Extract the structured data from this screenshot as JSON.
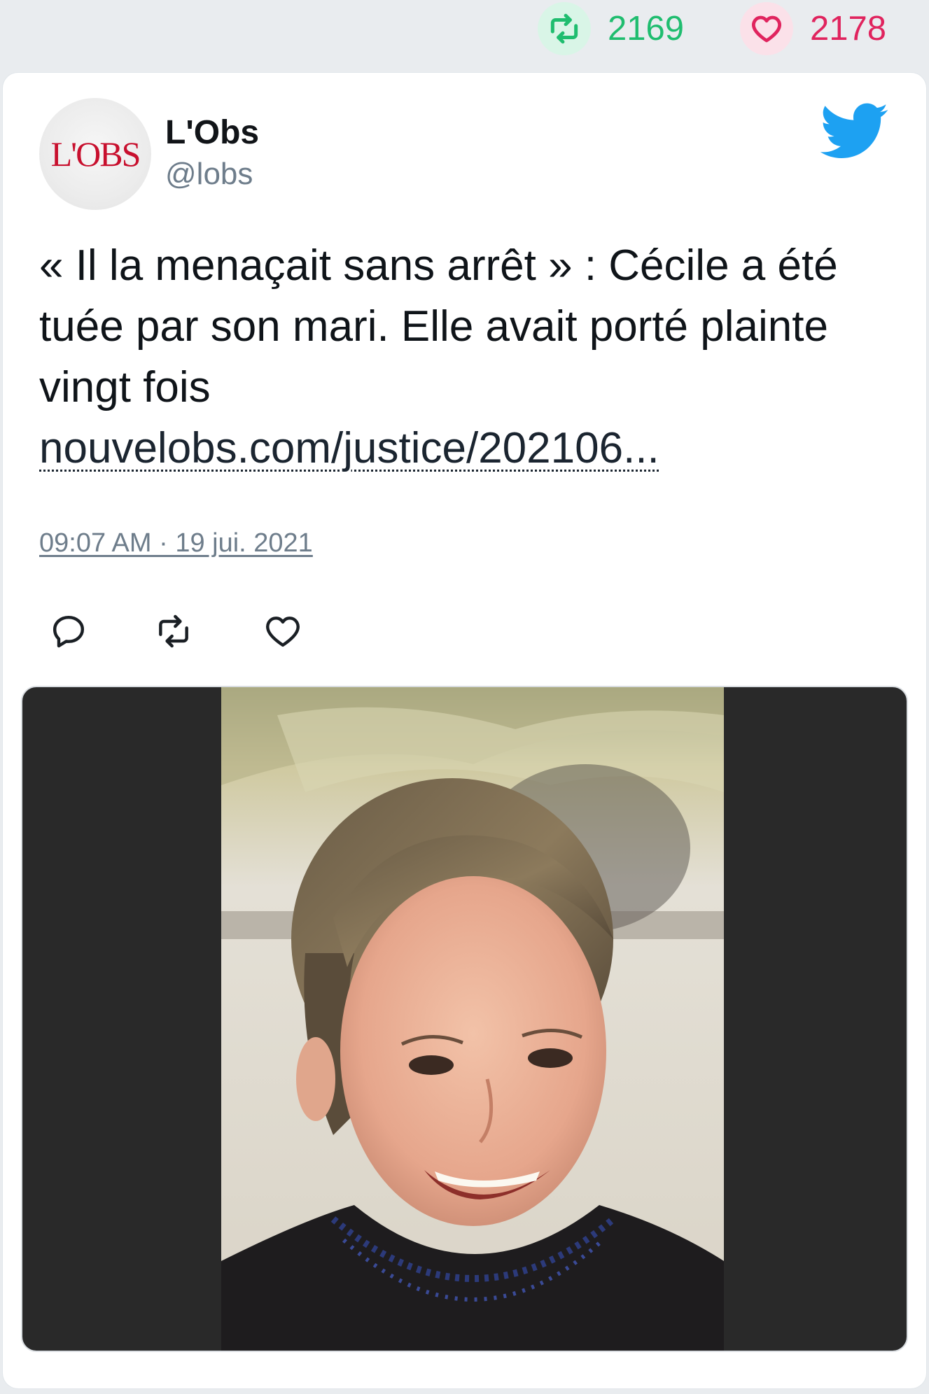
{
  "stats": {
    "retweets": "2169",
    "likes": "2178"
  },
  "author": {
    "name": "L'Obs",
    "handle": "@lobs",
    "avatar_logo": "L'OBS"
  },
  "tweet": {
    "text": "« Il la menaçait sans arrêt » : Cécile a été tuée par son mari. Elle avait porté plainte vingt fois",
    "link": "nouvelobs.com/justice/202106...",
    "timestamp": "09:07 AM · 19 jui. 2021"
  },
  "icons": {
    "brand": "twitter-bird-icon",
    "reply": "reply-icon",
    "retweet": "retweet-icon",
    "like": "heart-icon"
  },
  "colors": {
    "retweet": "#1fbd6f",
    "like": "#e0245e",
    "brand": "#1da1f2",
    "handle": "#6e7d8b"
  }
}
